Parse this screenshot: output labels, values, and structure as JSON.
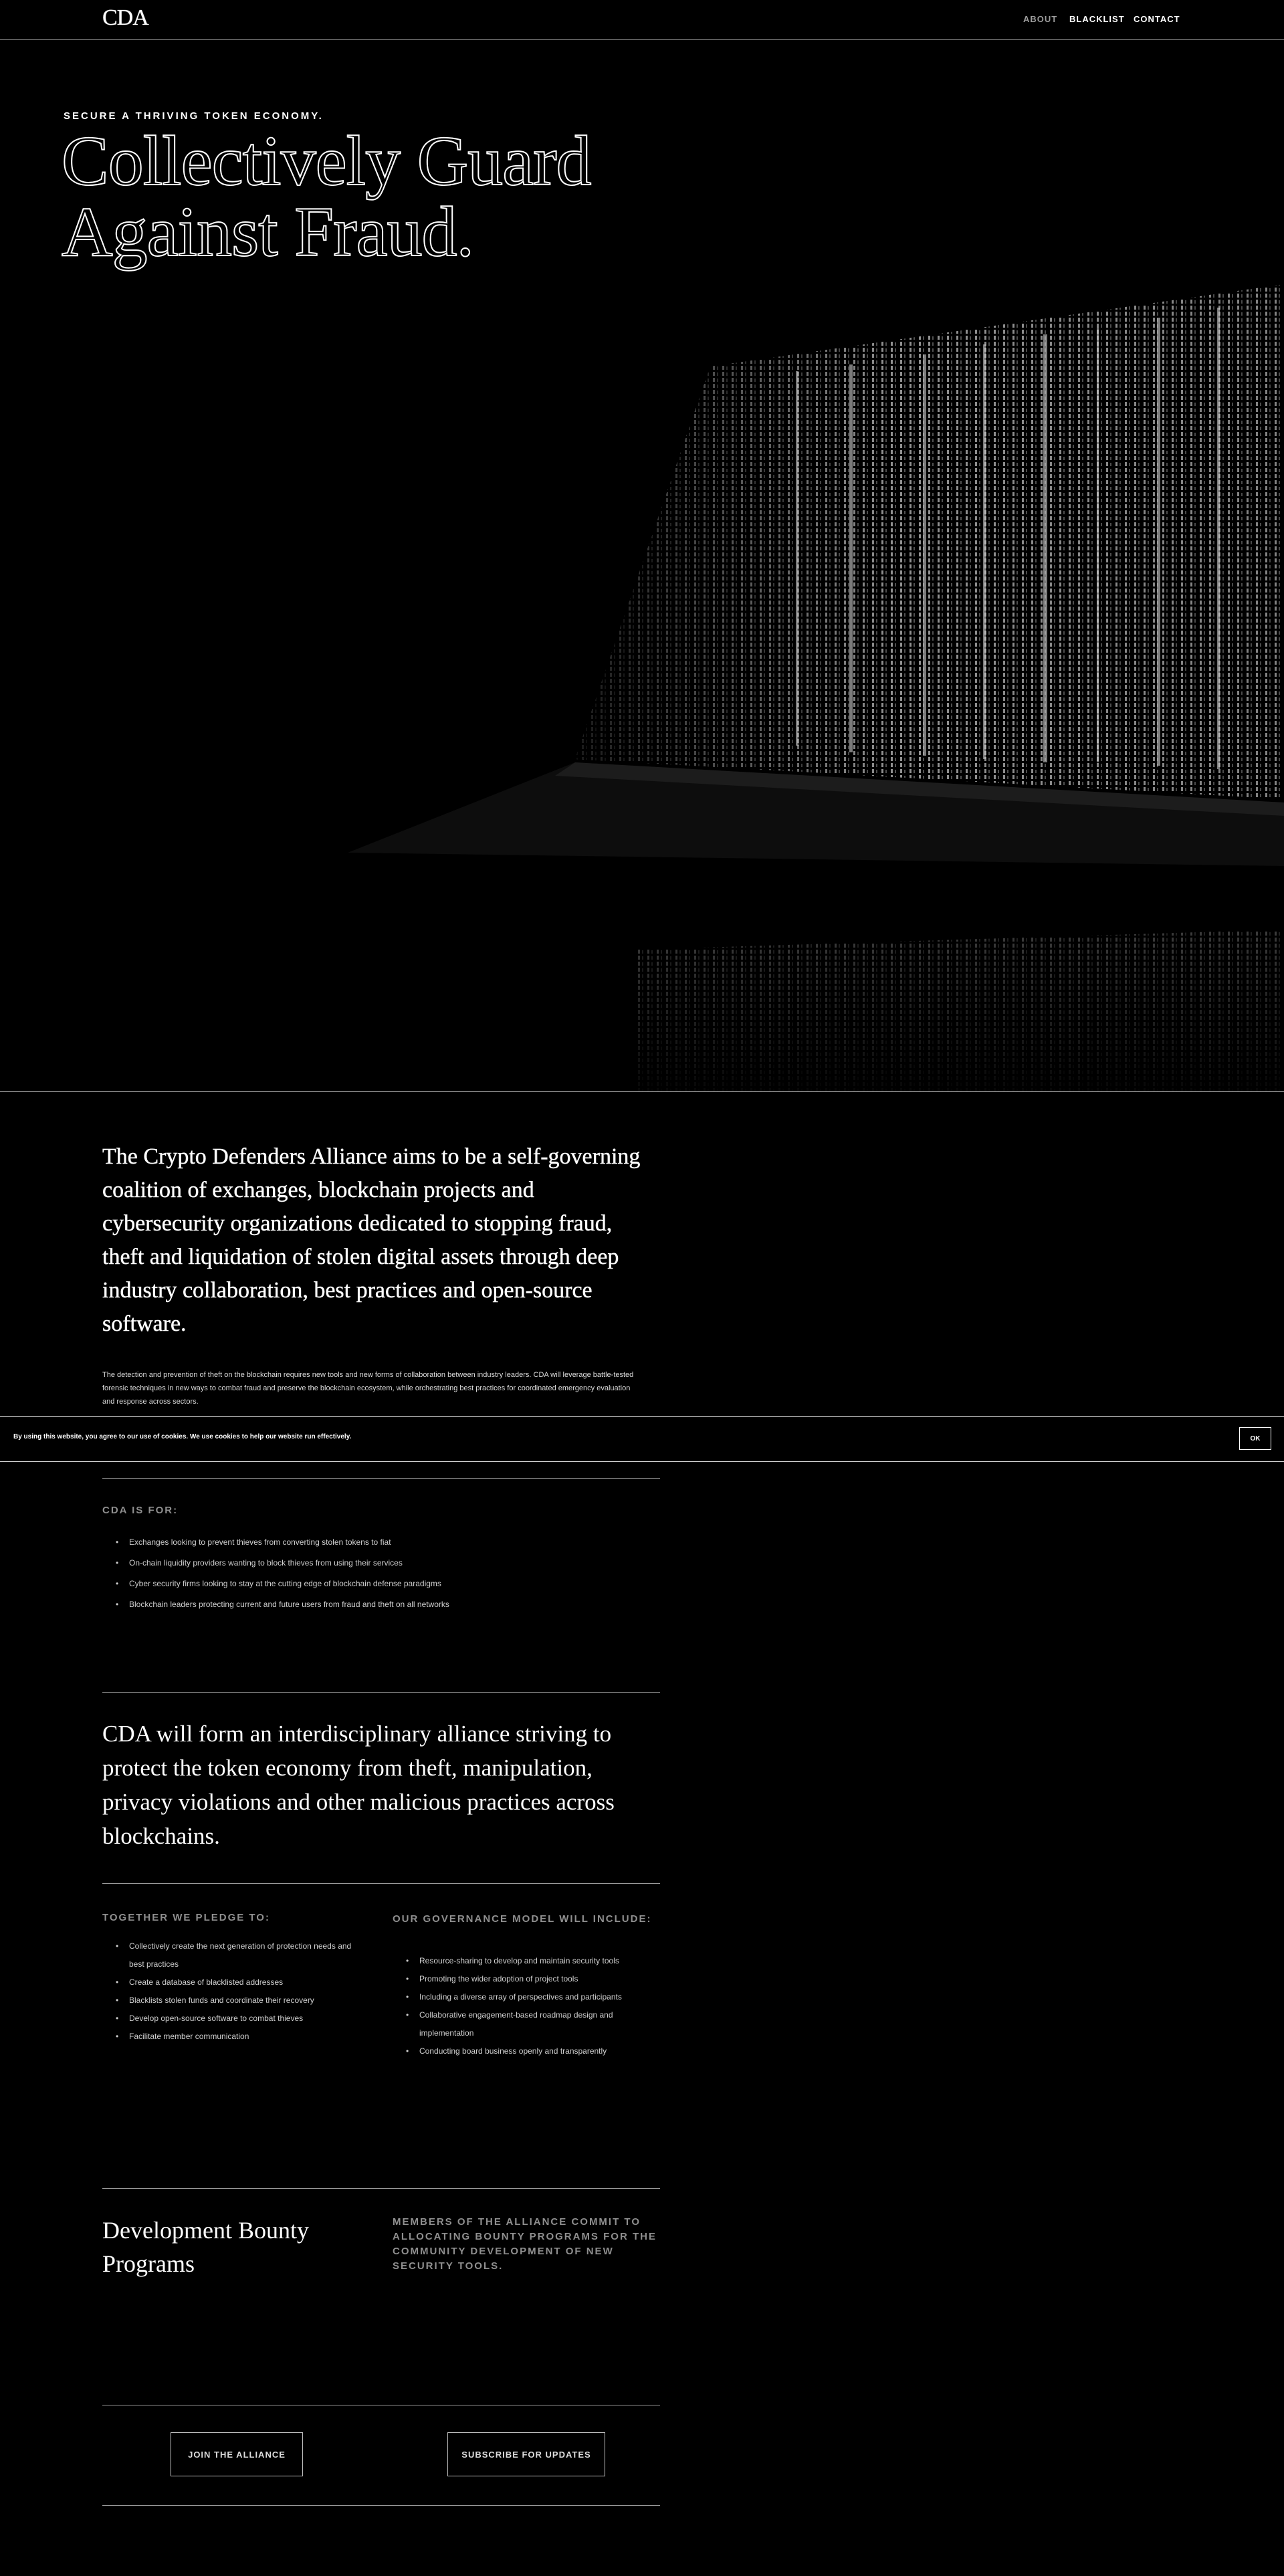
{
  "header": {
    "logo": "CDA",
    "nav": [
      {
        "label": "ABOUT"
      },
      {
        "label": "BLACKLIST"
      },
      {
        "label": "CONTACT"
      }
    ]
  },
  "hero": {
    "eyebrow": "SECURE A THRIVING TOKEN ECONOMY.",
    "title_line1": "Collectively Guard",
    "title_line2": "Against Fraud."
  },
  "intro": {
    "lead": "The Crypto Defenders Alliance aims to be a self-governing coalition of exchanges, blockchain projects and cybersecurity organizations dedicated to stopping fraud, theft and liquidation of stolen digital assets through deep industry collaboration, best practices and open-source software.",
    "body": "The detection and prevention of theft on the blockchain requires new tools and new forms of collaboration between industry leaders. CDA will leverage battle-tested forensic techniques in new ways to combat fraud and preserve the blockchain ecosystem, while orchestrating best practices for coordinated emergency evaluation and response across sectors."
  },
  "cookie": {
    "text": "By using this website, you agree to our use of cookies. We use cookies to help our website run effectively.",
    "ok": "OK"
  },
  "for_section": {
    "label": "CDA IS FOR:",
    "items": [
      "Exchanges looking to prevent thieves from converting stolen tokens to fiat",
      "On-chain liquidity providers wanting to block thieves from using their services",
      "Cyber security firms looking to stay at the cutting edge of blockchain defense paradigms",
      "Blockchain leaders protecting current and future users from fraud and theft on all networks"
    ]
  },
  "statement": "CDA will form an interdisciplinary alliance striving to protect the token economy from theft, manipulation, privacy violations and other malicious practices across blockchains.",
  "pledge": {
    "label": "TOGETHER WE PLEDGE TO:",
    "items": [
      "Collectively create the next generation of protection needs and best practices",
      "Create a database of blacklisted addresses",
      "Blacklists stolen funds and coordinate their recovery",
      "Develop open-source software to combat thieves",
      "Facilitate member communication"
    ]
  },
  "governance": {
    "label": "OUR GOVERNANCE MODEL WILL INCLUDE:",
    "items": [
      "Resource-sharing to develop and maintain security tools",
      "Promoting the wider adoption of project tools",
      "Including a diverse array of perspectives and participants",
      "Collaborative engagement-based roadmap design and implementation",
      "Conducting board business openly and transparently"
    ]
  },
  "bounty": {
    "title": "Development Bounty Programs",
    "desc": "MEMBERS OF THE ALLIANCE COMMIT TO ALLOCATING BOUNTY PROGRAMS FOR THE COMMUNITY DEVELOPMENT OF NEW SECURITY TOOLS."
  },
  "cta": {
    "join": "JOIN THE ALLIANCE",
    "subscribe": "SUBSCRIBE FOR UPDATES"
  }
}
